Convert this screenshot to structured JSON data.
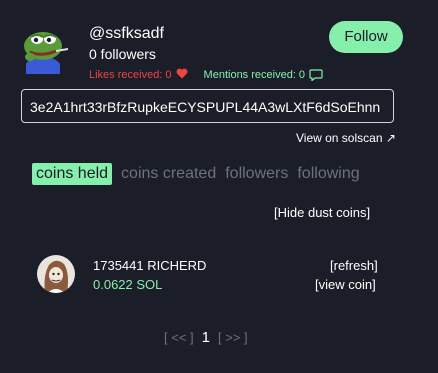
{
  "profile": {
    "username": "@ssfksadf",
    "followers": "0 followers",
    "likes_received": "Likes received: 0",
    "mentions_received": "Mentions received: 0",
    "follow_label": "Follow",
    "address": "3e2A1hrt33rBfzRupkeECYSPUPL44A3wLXtF6dSoEhnn",
    "view_on_solscan": "View on solscan ↗"
  },
  "tabs": [
    {
      "label": "coins held",
      "active": true
    },
    {
      "label": "coins created",
      "active": false
    },
    {
      "label": "followers",
      "active": false
    },
    {
      "label": "following",
      "active": false
    }
  ],
  "hide_dust_label": "[Hide dust coins]",
  "coins": [
    {
      "name": "1735441 RICHERD",
      "amount": "0.0622 SOL",
      "refresh_label": "[refresh]",
      "view_label": "[view coin]"
    }
  ],
  "pagination": {
    "prev_label": "[ << ]",
    "current_page": "1",
    "next_label": "[ >> ]"
  },
  "colors": {
    "background": "#1b1d28",
    "accent_green": "#86efac",
    "likes_red": "#ef4444",
    "muted": "#6b7280"
  },
  "icons": {
    "heart": "heart-icon",
    "mention": "speech-bubble-icon",
    "external_link": "external-link-icon"
  }
}
